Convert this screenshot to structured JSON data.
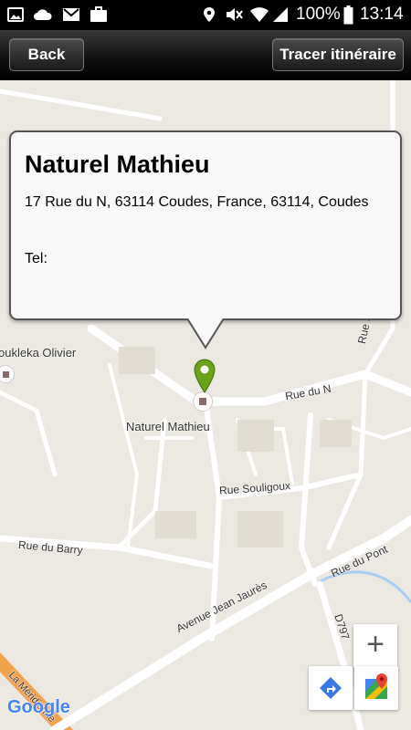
{
  "status_bar": {
    "battery": "100%",
    "time": "13:14"
  },
  "title_bar": {
    "back_label": "Back",
    "route_label": "Tracer itinéraire"
  },
  "info_window": {
    "name": "Naturel Mathieu",
    "address": "17 Rue du N, 63114 Coudes, France, 63114, Coudes",
    "tel": "Tel:"
  },
  "map": {
    "labels": {
      "neighbor": "oukleka Olivier",
      "place": "Naturel Mathieu",
      "rue_du_n": "Rue du N",
      "rue_souligoux": "Rue Souligoux",
      "rue_du_barry": "Rue du Barry",
      "rue_du_pont": "Rue du Pont",
      "avenue_jean_jaures": "Avenue Jean Jaurès",
      "d797": "D797",
      "la_meridienne": "La Méridienne",
      "rue_sa": "Rue Sa"
    },
    "zoom_in_label": "+",
    "google_logo": "Google"
  }
}
